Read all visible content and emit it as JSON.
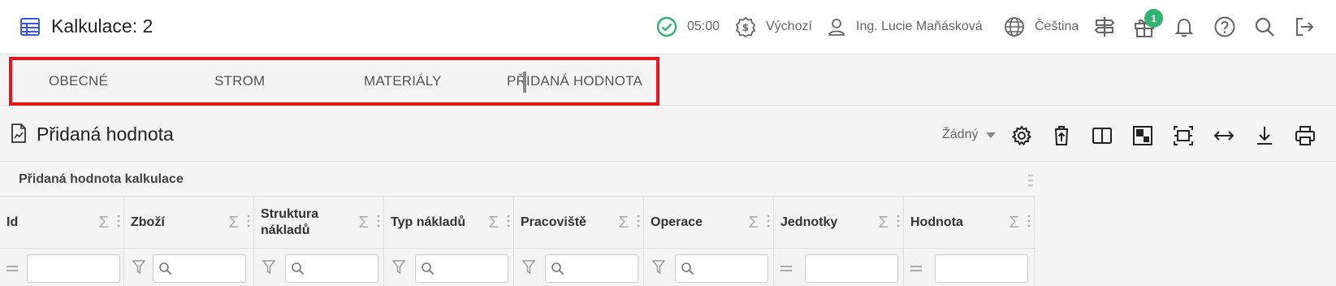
{
  "header": {
    "title": "Kalkulace: 2",
    "timer": "05:00",
    "currency": "Výchozí",
    "user": "Ing. Lucie Maňásková",
    "language": "Čeština",
    "gift_badge": "1"
  },
  "tabs": [
    {
      "label": "OBECNÉ"
    },
    {
      "label": "STROM"
    },
    {
      "label": "MATERIÁLY"
    },
    {
      "label": "PŘIDANÁ HODNOTA",
      "active": true
    }
  ],
  "section": {
    "title": "Přidaná hodnota",
    "layout_selector": "Žádný"
  },
  "grid": {
    "caption": "Přidaná hodnota kalkulace",
    "columns": [
      {
        "label": "Id",
        "filter": "eq"
      },
      {
        "label": "Zboží",
        "filter": "search"
      },
      {
        "label": "Struktura nákladů",
        "filter": "search"
      },
      {
        "label": "Typ nákladů",
        "filter": "search"
      },
      {
        "label": "Pracoviště",
        "filter": "search"
      },
      {
        "label": "Operace",
        "filter": "search"
      },
      {
        "label": "Jednotky",
        "filter": "eq"
      },
      {
        "label": "Hodnota",
        "filter": "eq"
      }
    ],
    "sigma": "Σ"
  },
  "colors": {
    "accent": "#3a5bd9",
    "success": "#2fb371",
    "highlight": "#e3161b"
  }
}
